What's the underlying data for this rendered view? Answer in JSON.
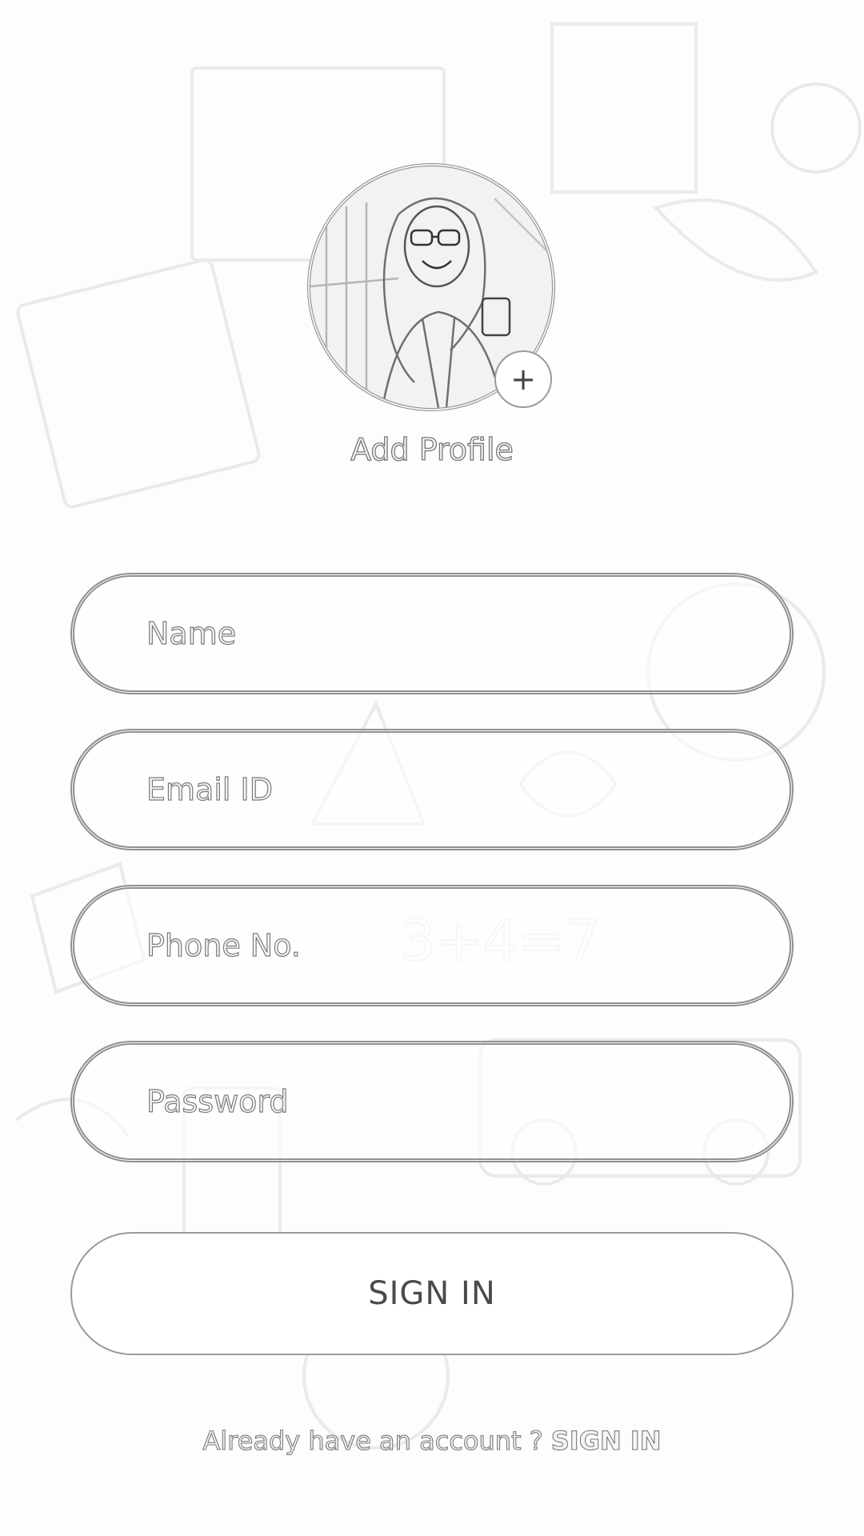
{
  "profile": {
    "add_label": "Add Profile",
    "add_badge_icon": "plus-icon",
    "add_badge_glyph": "+"
  },
  "form": {
    "name_placeholder": "Name",
    "email_placeholder": "Email ID",
    "phone_placeholder": "Phone No.",
    "password_placeholder": "Password",
    "submit_label": "SIGN IN"
  },
  "footer": {
    "prompt": "Already have an account ?",
    "link_label": "SIGN IN"
  }
}
